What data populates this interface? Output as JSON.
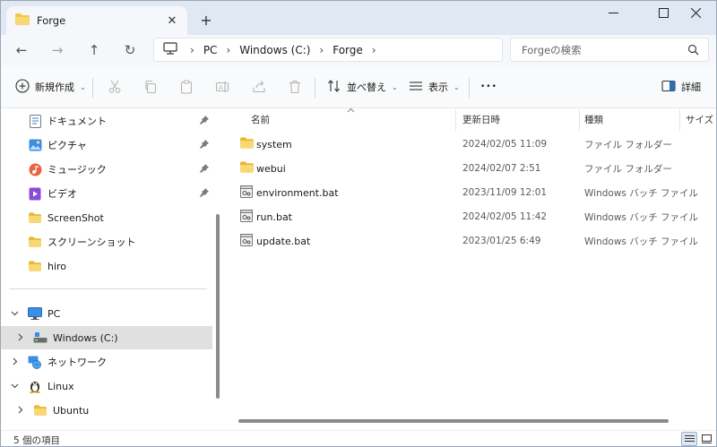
{
  "window": {
    "tab_title": "Forge",
    "tab_close": "✕",
    "new_tab": "+"
  },
  "nav": {
    "back": "←",
    "forward": "→",
    "up": "↑",
    "refresh": "↻"
  },
  "address": {
    "crumbs": [
      "PC",
      "Windows (C:)",
      "Forge"
    ],
    "separator": "›"
  },
  "search": {
    "placeholder": "Forgeの検索"
  },
  "commandbar": {
    "new_label": "新規作成",
    "sort_label": "並べ替え",
    "view_label": "表示",
    "more_label": "•••",
    "details_label": "詳細",
    "caret": "⌄"
  },
  "sidebar": {
    "quick_access": [
      {
        "label": "ドキュメント",
        "icon": "documents-icon",
        "pinned": true
      },
      {
        "label": "ピクチャ",
        "icon": "pictures-icon",
        "pinned": true
      },
      {
        "label": "ミュージック",
        "icon": "music-icon",
        "pinned": true
      },
      {
        "label": "ビデオ",
        "icon": "videos-icon",
        "pinned": true
      },
      {
        "label": "ScreenShot",
        "icon": "folder-icon",
        "pinned": false
      },
      {
        "label": "スクリーンショット",
        "icon": "folder-icon",
        "pinned": false
      },
      {
        "label": "hiro",
        "icon": "folder-icon",
        "pinned": false
      }
    ],
    "tree": [
      {
        "label": "PC",
        "icon": "pc-icon",
        "expanded": true
      },
      {
        "label": "Windows (C:)",
        "icon": "drive-icon",
        "selected": true
      },
      {
        "label": "ネットワーク",
        "icon": "network-icon",
        "expanded": false
      },
      {
        "label": "Linux",
        "icon": "linux-icon",
        "expanded": true
      },
      {
        "label": "Ubuntu",
        "icon": "folder-icon",
        "expanded": false
      }
    ]
  },
  "columns": {
    "name": "名前",
    "date": "更新日時",
    "type": "種類",
    "size": "サイズ"
  },
  "files": [
    {
      "name": "system",
      "date": "2024/02/05 11:09",
      "type": "ファイル フォルダー",
      "icon": "folder-icon"
    },
    {
      "name": "webui",
      "date": "2024/02/07 2:51",
      "type": "ファイル フォルダー",
      "icon": "folder-icon"
    },
    {
      "name": "environment.bat",
      "date": "2023/11/09 12:01",
      "type": "Windows バッチ ファイル",
      "icon": "batch-file-icon"
    },
    {
      "name": "run.bat",
      "date": "2024/02/05 11:42",
      "type": "Windows バッチ ファイル",
      "icon": "batch-file-icon"
    },
    {
      "name": "update.bat",
      "date": "2023/01/25 6:49",
      "type": "Windows バッチ ファイル",
      "icon": "batch-file-icon"
    }
  ],
  "status": {
    "item_count": "5 個の項目"
  },
  "colors": {
    "folder": "#f2c94c",
    "accent": "#0067c0"
  }
}
